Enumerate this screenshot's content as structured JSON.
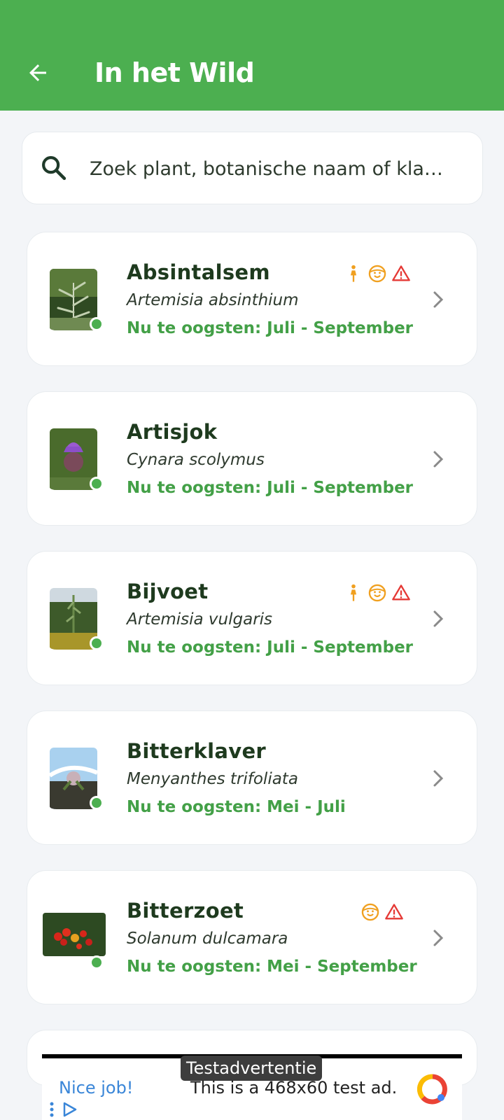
{
  "appbar": {
    "title": "In het Wild",
    "color": "#4caf50",
    "back_icon": "arrow-left-icon"
  },
  "search": {
    "placeholder": "Zoek plant, botanische naam of kla…",
    "value": "",
    "icon": "search-icon"
  },
  "plants": [
    {
      "name": "Absintalsem",
      "botanical": "Artemisia absinthium",
      "harvest": "Nu te oogsten: Juli - September",
      "badges": [
        "pregnancy-icon",
        "child-icon",
        "warning-icon"
      ],
      "status_color": "#4caf50"
    },
    {
      "name": "Artisjok",
      "botanical": "Cynara scolymus",
      "harvest": "Nu te oogsten: Juli - September",
      "badges": [],
      "status_color": "#4caf50"
    },
    {
      "name": "Bijvoet",
      "botanical": "Artemisia vulgaris",
      "harvest": "Nu te oogsten: Juli - September",
      "badges": [
        "pregnancy-icon",
        "child-icon",
        "warning-icon"
      ],
      "status_color": "#4caf50"
    },
    {
      "name": "Bitterklaver",
      "botanical": "Menyanthes trifoliata",
      "harvest": "Nu te oogsten: Mei - Juli",
      "badges": [],
      "status_color": "#4caf50"
    },
    {
      "name": "Bitterzoet",
      "botanical": "Solanum dulcamara",
      "harvest": "Nu te oogsten: Mei - September",
      "badges": [
        "child-icon",
        "warning-icon"
      ],
      "status_color": "#4caf50"
    }
  ],
  "ad": {
    "label": "Testadvertentie",
    "headline": "Nice job!",
    "text": "This is a 468x60 test ad."
  }
}
